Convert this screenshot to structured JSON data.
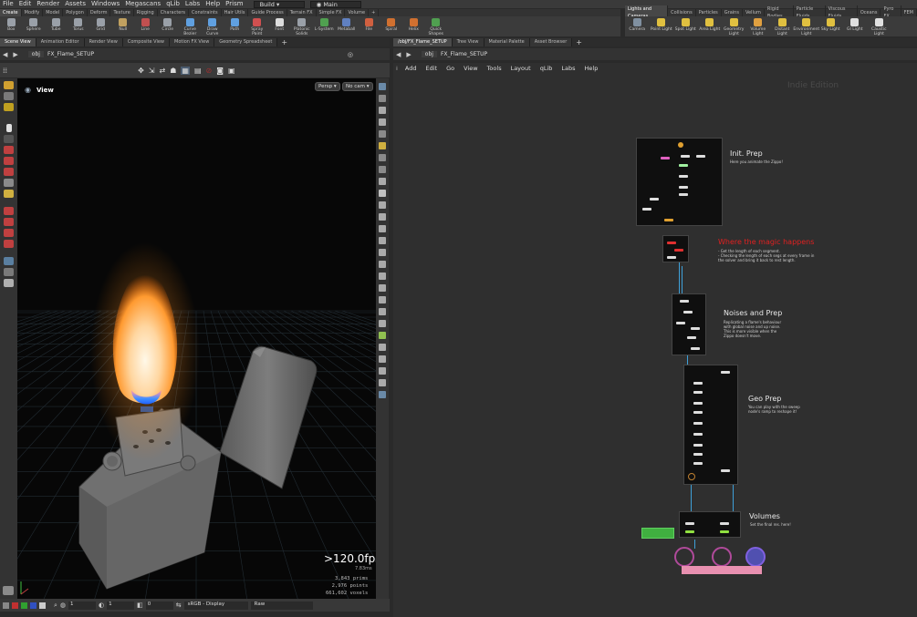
{
  "menubar": {
    "items": [
      "File",
      "Edit",
      "Render",
      "Assets",
      "Windows",
      "Megascans",
      "qLib",
      "Labs",
      "Help",
      "Prism"
    ],
    "desktop": "Build",
    "context": "Main"
  },
  "shelf_tabs_left": [
    "Create",
    "Modify",
    "Model",
    "Polygon",
    "Deform",
    "Texture",
    "Rigging",
    "Characters",
    "Constraints",
    "Hair Utils",
    "Guide Process",
    "Terrain FX",
    "Simple FX",
    "Volume"
  ],
  "shelf_tabs_right": [
    "Lights and Cameras",
    "Collisions",
    "Particles",
    "Grains",
    "Vellum",
    "Rigid Bodies",
    "Particle Fluids",
    "Viscous Fluids",
    "Oceans",
    "Pyro FX",
    "FEM"
  ],
  "shelf_tools_left": [
    {
      "label": "Box",
      "icon": "box-icon",
      "color": "#9aa0a8"
    },
    {
      "label": "Sphere",
      "icon": "sphere-icon",
      "color": "#9aa0a8"
    },
    {
      "label": "Tube",
      "icon": "tube-icon",
      "color": "#9aa0a8"
    },
    {
      "label": "Torus",
      "icon": "torus-icon",
      "color": "#9aa0a8"
    },
    {
      "label": "Grid",
      "icon": "grid-icon",
      "color": "#9aa0a8"
    },
    {
      "label": "Null",
      "icon": "null-icon",
      "color": "#c0a060"
    },
    {
      "label": "Line",
      "icon": "line-icon",
      "color": "#c05050"
    },
    {
      "label": "Circle",
      "icon": "circle-icon",
      "color": "#9aa0a8"
    },
    {
      "label": "Curve Bezier",
      "icon": "curve-bezier-icon",
      "color": "#60a0e0"
    },
    {
      "label": "Draw Curve",
      "icon": "draw-curve-icon",
      "color": "#60a0e0"
    },
    {
      "label": "Path",
      "icon": "path-icon",
      "color": "#60a0e0"
    },
    {
      "label": "Spray Paint",
      "icon": "spray-paint-icon",
      "color": "#d05050"
    },
    {
      "label": "Font",
      "icon": "font-icon",
      "color": "#dddddd"
    },
    {
      "label": "Platonic Solids",
      "icon": "platonic-solids-icon",
      "color": "#9aa0a8"
    },
    {
      "label": "L-System",
      "icon": "l-system-icon",
      "color": "#50a050"
    },
    {
      "label": "Metaball",
      "icon": "metaball-icon",
      "color": "#6080c0"
    },
    {
      "label": "File",
      "icon": "file-icon",
      "color": "#d06040"
    },
    {
      "label": "Spiral",
      "icon": "spiral-icon",
      "color": "#d07030"
    },
    {
      "label": "Helix",
      "icon": "helix-icon",
      "color": "#d07030"
    },
    {
      "label": "Quick Shapes",
      "icon": "quick-shapes-icon",
      "color": "#50a050"
    }
  ],
  "shelf_tools_right": [
    {
      "label": "Camera",
      "icon": "camera-icon",
      "color": "#8090a0"
    },
    {
      "label": "Point Light",
      "icon": "point-light-icon",
      "color": "#e0c040"
    },
    {
      "label": "Spot Light",
      "icon": "spot-light-icon",
      "color": "#e0c040"
    },
    {
      "label": "Area Light",
      "icon": "area-light-icon",
      "color": "#e0c040"
    },
    {
      "label": "Geometry Light",
      "icon": "geometry-light-icon",
      "color": "#e0c040"
    },
    {
      "label": "Volume Light",
      "icon": "volume-light-icon",
      "color": "#e0a040"
    },
    {
      "label": "Distant Light",
      "icon": "distant-light-icon",
      "color": "#e0c040"
    },
    {
      "label": "Environment Light",
      "icon": "environment-light-icon",
      "color": "#e0c040"
    },
    {
      "label": "Sky Light",
      "icon": "sky-light-icon",
      "color": "#e0c040"
    },
    {
      "label": "GI Light",
      "icon": "gi-light-icon",
      "color": "#e0e0e0"
    },
    {
      "label": "Caustic Light",
      "icon": "caustic-light-icon",
      "color": "#e0e0e0"
    }
  ],
  "left_pane": {
    "tabs": [
      "Scene View",
      "Animation Editor",
      "Render View",
      "Composite View",
      "Motion FX View",
      "Geometry Spreadsheet"
    ],
    "path": [
      "obj",
      "FX_Flame_SETUP"
    ],
    "viewport_label": "View",
    "persp": "Persp",
    "cam": "No cam",
    "fps": ">120.0fps",
    "ms": "7.83ms",
    "stats": [
      {
        "num": "3,843",
        "label": "prims"
      },
      {
        "num": "2,976",
        "label": "points"
      },
      {
        "num": "661,602",
        "label": "voxels"
      }
    ],
    "bottom": {
      "field1": "1",
      "field2": "1",
      "field3": "0",
      "display": "sRGB - Display",
      "raw": "Raw"
    }
  },
  "right_pane": {
    "tabs": [
      "/obj/FX_Flame_SETUP",
      "Tree View",
      "Material Palette",
      "Asset Browser"
    ],
    "path": [
      "obj",
      "FX_Flame_SETUP"
    ],
    "menu": [
      "Add",
      "Edit",
      "Go",
      "View",
      "Tools",
      "Layout",
      "qLib",
      "Labs",
      "Help"
    ],
    "watermark": "Indie Edition"
  },
  "network_sections": [
    {
      "title": "Init. Prep",
      "desc": [
        "Here you animate the Zippo!"
      ],
      "color": "#e8e8e8"
    },
    {
      "title": "Where the magic happens",
      "desc": [
        "- Get the length of each segment.",
        "- Checking the length of each segs at every frame in",
        "the solver and bring it back to rest length."
      ],
      "color": "#e02020"
    },
    {
      "title": "Noises and Prep",
      "desc": [
        "Replicating a flame's behaviour",
        "with global noise and up noise.",
        "This is more visible when the",
        "Zippo doesn't move."
      ],
      "color": "#e8e8e8"
    },
    {
      "title": "Geo Prep",
      "desc": [
        "You can play with the sweep",
        "node's ramp to reshape it!"
      ],
      "color": "#e8e8e8"
    },
    {
      "title": "Volumes",
      "desc": [
        "Set the final res. here!"
      ],
      "color": "#e8e8e8"
    }
  ]
}
